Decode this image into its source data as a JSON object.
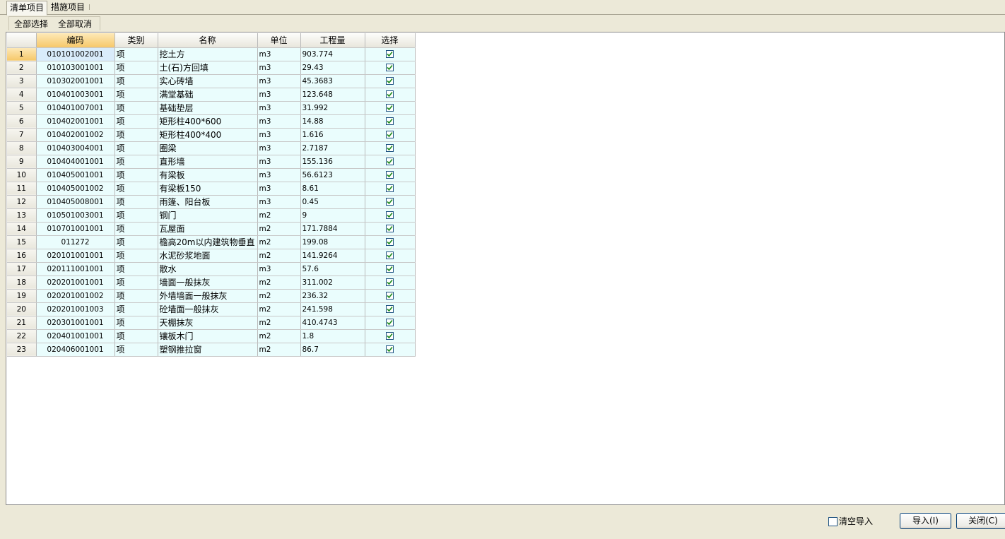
{
  "tabs": [
    "清单项目",
    "措施项目"
  ],
  "toolbar": {
    "select_all": "全部选择",
    "deselect_all": "全部取消"
  },
  "columns": [
    "编码",
    "类别",
    "名称",
    "单位",
    "工程量",
    "选择"
  ],
  "rows": [
    {
      "num": "1",
      "code": "010101002001",
      "type": "项",
      "name": "挖土方",
      "unit": "m3",
      "qty": "903.774",
      "selected": true
    },
    {
      "num": "2",
      "code": "010103001001",
      "type": "项",
      "name": "土(石)方回填",
      "unit": "m3",
      "qty": "29.43",
      "selected": true
    },
    {
      "num": "3",
      "code": "010302001001",
      "type": "项",
      "name": "实心砖墙",
      "unit": "m3",
      "qty": "45.3683",
      "selected": true
    },
    {
      "num": "4",
      "code": "010401003001",
      "type": "项",
      "name": "满堂基础",
      "unit": "m3",
      "qty": "123.648",
      "selected": true
    },
    {
      "num": "5",
      "code": "010401007001",
      "type": "项",
      "name": "基础垫层",
      "unit": "m3",
      "qty": "31.992",
      "selected": true
    },
    {
      "num": "6",
      "code": "010402001001",
      "type": "项",
      "name": "矩形柱400*600",
      "unit": "m3",
      "qty": "14.88",
      "selected": true
    },
    {
      "num": "7",
      "code": "010402001002",
      "type": "项",
      "name": "矩形柱400*400",
      "unit": "m3",
      "qty": "1.616",
      "selected": true
    },
    {
      "num": "8",
      "code": "010403004001",
      "type": "项",
      "name": "圈梁",
      "unit": "m3",
      "qty": "2.7187",
      "selected": true
    },
    {
      "num": "9",
      "code": "010404001001",
      "type": "项",
      "name": "直形墙",
      "unit": "m3",
      "qty": "155.136",
      "selected": true
    },
    {
      "num": "10",
      "code": "010405001001",
      "type": "项",
      "name": "有梁板",
      "unit": "m3",
      "qty": "56.6123",
      "selected": true
    },
    {
      "num": "11",
      "code": "010405001002",
      "type": "项",
      "name": "有梁板150",
      "unit": "m3",
      "qty": "8.61",
      "selected": true
    },
    {
      "num": "12",
      "code": "010405008001",
      "type": "项",
      "name": "雨篷、阳台板",
      "unit": "m3",
      "qty": "0.45",
      "selected": true
    },
    {
      "num": "13",
      "code": "010501003001",
      "type": "项",
      "name": "钢门",
      "unit": "m2",
      "qty": "9",
      "selected": true
    },
    {
      "num": "14",
      "code": "010701001001",
      "type": "项",
      "name": "瓦屋面",
      "unit": "m2",
      "qty": "171.7884",
      "selected": true
    },
    {
      "num": "15",
      "code": "011272",
      "type": "项",
      "name": "檐高20m以内建筑物垂直",
      "unit": "m2",
      "qty": "199.08",
      "selected": true
    },
    {
      "num": "16",
      "code": "020101001001",
      "type": "项",
      "name": "水泥砂浆地面",
      "unit": "m2",
      "qty": "141.9264",
      "selected": true
    },
    {
      "num": "17",
      "code": "020111001001",
      "type": "项",
      "name": "散水",
      "unit": "m3",
      "qty": "57.6",
      "selected": true
    },
    {
      "num": "18",
      "code": "020201001001",
      "type": "项",
      "name": "墙面一般抹灰",
      "unit": "m2",
      "qty": "311.002",
      "selected": true
    },
    {
      "num": "19",
      "code": "020201001002",
      "type": "项",
      "name": "外墙墙面一般抹灰",
      "unit": "m2",
      "qty": "236.32",
      "selected": true
    },
    {
      "num": "20",
      "code": "020201001003",
      "type": "项",
      "name": "砼墙面一般抹灰",
      "unit": "m2",
      "qty": "241.598",
      "selected": true
    },
    {
      "num": "21",
      "code": "020301001001",
      "type": "项",
      "name": "天棚抹灰",
      "unit": "m2",
      "qty": "410.4743",
      "selected": true
    },
    {
      "num": "22",
      "code": "020401001001",
      "type": "项",
      "name": "镶板木门",
      "unit": "m2",
      "qty": "1.8",
      "selected": true
    },
    {
      "num": "23",
      "code": "020406001001",
      "type": "项",
      "name": "塑钢推拉窗",
      "unit": "m2",
      "qty": "86.7",
      "selected": true
    }
  ],
  "footer": {
    "clear_import_label": "清空导入",
    "clear_import_checked": false,
    "import_button": "导入(I)",
    "close_button": "关闭(C)"
  },
  "colors": {
    "cell_bg": "#eafdfd",
    "header_highlight": "#f6c86a",
    "check_mark": "#1b8a1b"
  }
}
